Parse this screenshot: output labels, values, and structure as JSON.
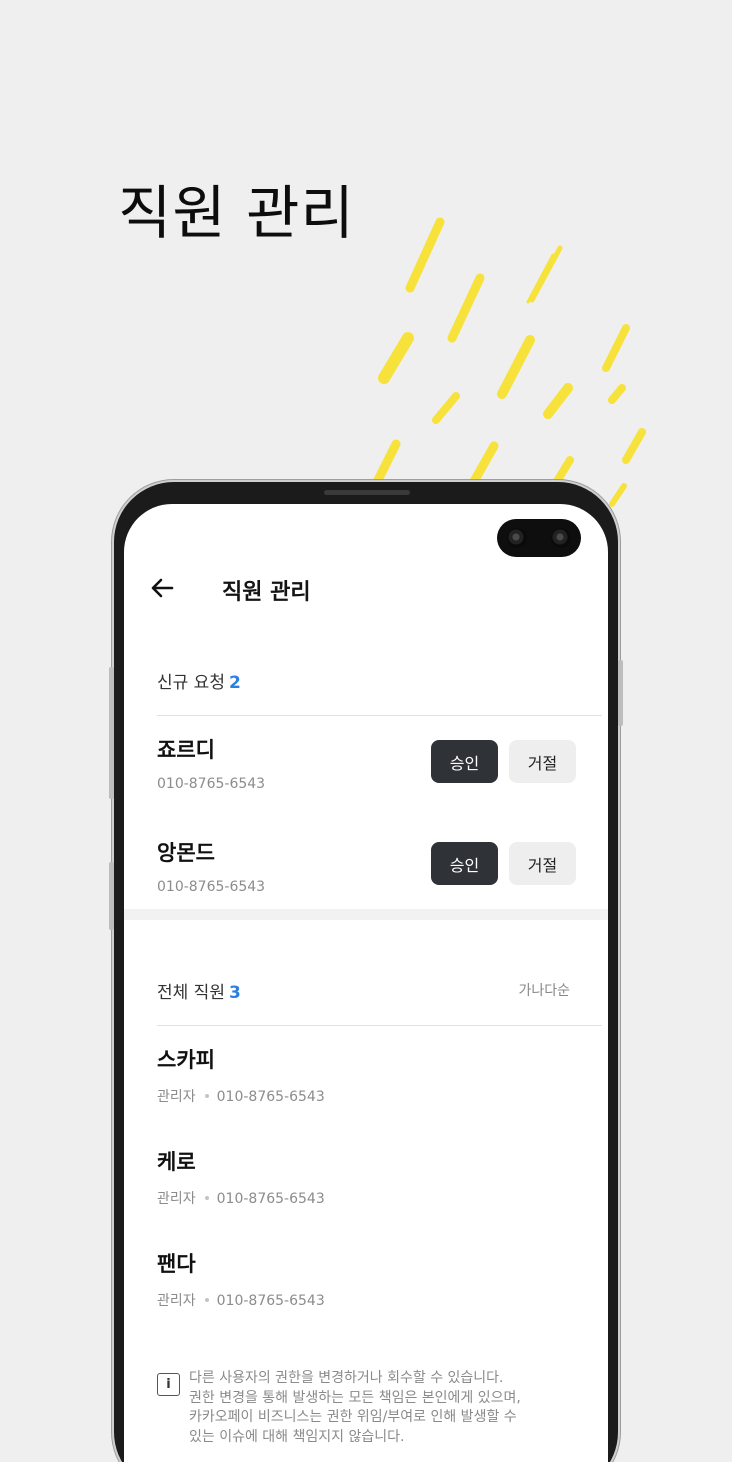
{
  "hero": {
    "title": "직원 관리"
  },
  "app": {
    "title": "직원 관리",
    "back_icon": "arrow-left-icon"
  },
  "pending": {
    "label": "신규 요청",
    "count": "2",
    "items": [
      {
        "name": "죠르디",
        "phone": "010-8765-6543",
        "approve_label": "승인",
        "reject_label": "거절"
      },
      {
        "name": "앙몬드",
        "phone": "010-8765-6543",
        "approve_label": "승인",
        "reject_label": "거절"
      }
    ]
  },
  "staff": {
    "label": "전체 직원",
    "count": "3",
    "sort_label": "가나다순",
    "items": [
      {
        "name": "스카피",
        "role": "관리자",
        "phone": "010-8765-6543"
      },
      {
        "name": "케로",
        "role": "관리자",
        "phone": "010-8765-6543"
      },
      {
        "name": "팬다",
        "role": "관리자",
        "phone": "010-8765-6543"
      }
    ]
  },
  "notice": {
    "icon": "info-icon",
    "icon_glyph": "i",
    "lines": [
      "다른 사용자의 권한을 변경하거나 회수할 수 있습니다.",
      "권한 변경을 통해 발생하는 모든 책임은 본인에게 있으며,",
      "카카오페이 비즈니스는 권한 위임/부여로 인해 발생할 수",
      "있는 이슈에 대해 책임지지 않습니다."
    ]
  },
  "colors": {
    "accent_blue": "#2a7fe0",
    "approve_bg": "#2f3338",
    "brush_yellow": "#f7e23b",
    "background": "#efefef"
  }
}
